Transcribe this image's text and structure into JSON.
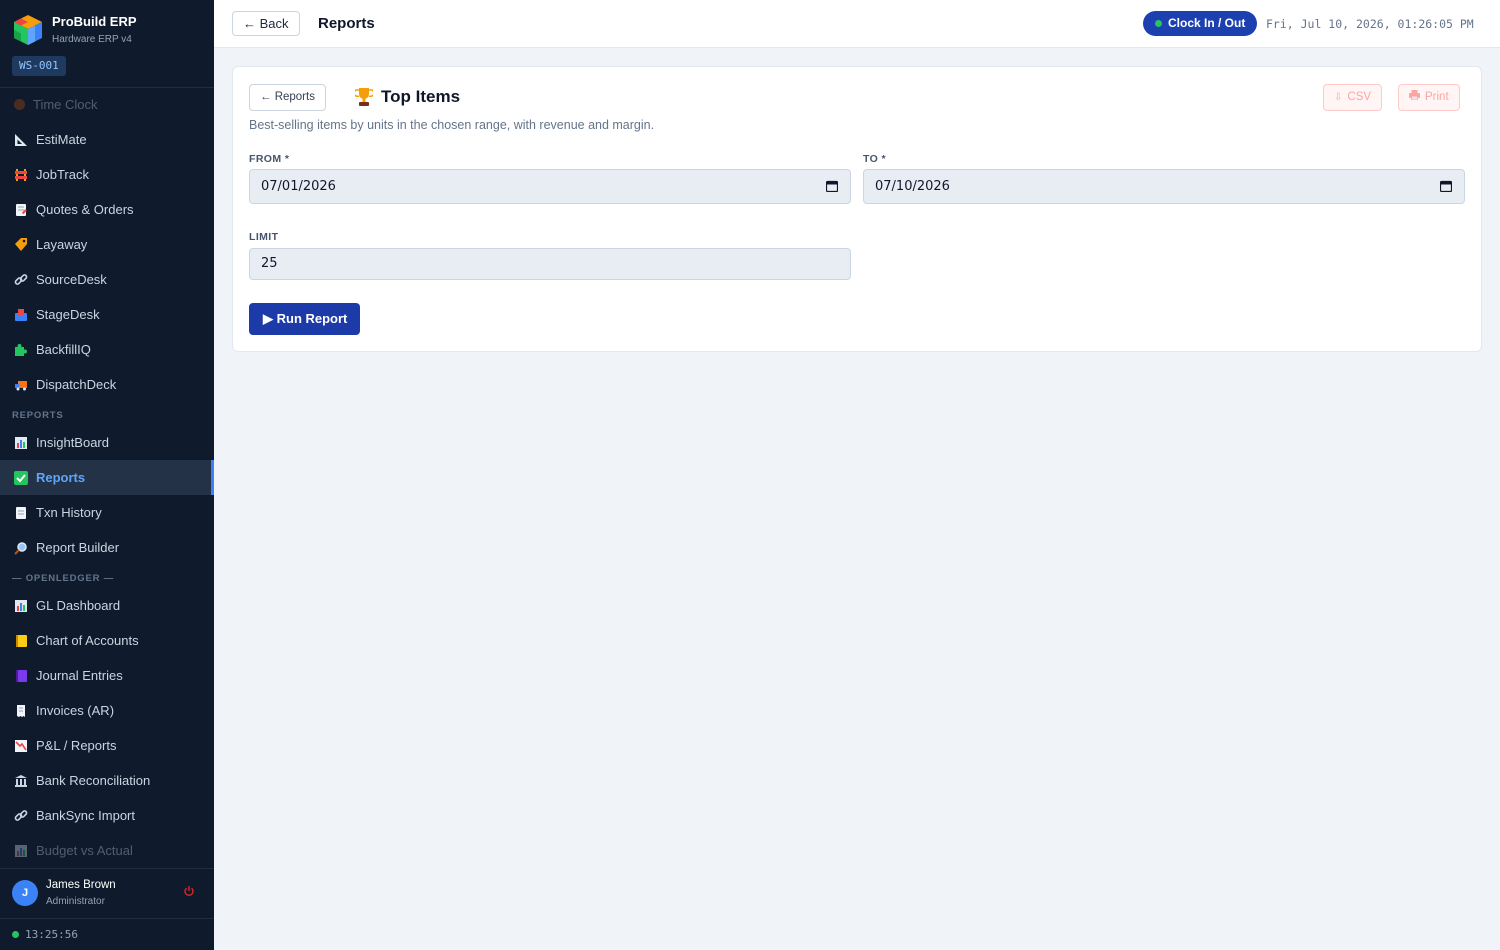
{
  "brand": {
    "name": "ProBuild ERP",
    "subtitle": "Hardware ERP v4",
    "workstation": "WS-001"
  },
  "sidebar": {
    "items_top": [
      {
        "label": "Time Clock",
        "icon": "time-clock-icon"
      },
      {
        "label": "EstiMate",
        "icon": "ruler-icon"
      },
      {
        "label": "JobTrack",
        "icon": "construction-icon"
      },
      {
        "label": "Quotes & Orders",
        "icon": "memo-icon"
      },
      {
        "label": "Layaway",
        "icon": "tag-icon"
      },
      {
        "label": "SourceDesk",
        "icon": "link-icon"
      },
      {
        "label": "StageDesk",
        "icon": "inbox-icon"
      },
      {
        "label": "BackfillIQ",
        "icon": "puzzle-icon"
      },
      {
        "label": "DispatchDeck",
        "icon": "truck-icon"
      }
    ],
    "section_reports": "REPORTS",
    "items_reports": [
      {
        "label": "InsightBoard",
        "icon": "bar-chart-icon"
      },
      {
        "label": "Reports",
        "icon": "checkmark-icon",
        "active": true
      },
      {
        "label": "Txn History",
        "icon": "document-icon"
      },
      {
        "label": "Report Builder",
        "icon": "magnifier-icon"
      }
    ],
    "section_ledger": "— OPENLEDGER —",
    "items_ledger": [
      {
        "label": "GL Dashboard",
        "icon": "bar-chart-icon"
      },
      {
        "label": "Chart of Accounts",
        "icon": "ledger-icon"
      },
      {
        "label": "Journal Entries",
        "icon": "notebook-icon"
      },
      {
        "label": "Invoices (AR)",
        "icon": "receipt-icon"
      },
      {
        "label": "P&L / Reports",
        "icon": "chart-down-icon"
      },
      {
        "label": "Bank Reconciliation",
        "icon": "bank-icon"
      },
      {
        "label": "BankSync Import",
        "icon": "link-icon"
      },
      {
        "label": "Budget vs Actual",
        "icon": "bar-chart-icon"
      }
    ]
  },
  "user": {
    "initial": "J",
    "name": "James Brown",
    "role": "Administrator",
    "clock": "13:25:56"
  },
  "topbar": {
    "back_label": "← Back",
    "title": "Reports",
    "clock_button": "Clock In / Out",
    "datetime": "Fri, Jul 10, 2026, 01:26:05 PM"
  },
  "report": {
    "back_label": "← Reports",
    "title": "Top Items",
    "csv_label": "CSV",
    "print_label": "Print",
    "description": "Best-selling items by units in the chosen range, with revenue and margin.",
    "from_label": "FROM *",
    "from_value": "07/01/2026",
    "to_label": "TO *",
    "to_value": "07/10/2026",
    "limit_label": "LIMIT",
    "limit_value": "25",
    "run_label": "▶ Run Report"
  },
  "colors": {
    "sidebar_bg": "#0f1b2d",
    "accent": "#1d40b0",
    "active_text": "#60a5fa",
    "status_green": "#22c55e"
  }
}
